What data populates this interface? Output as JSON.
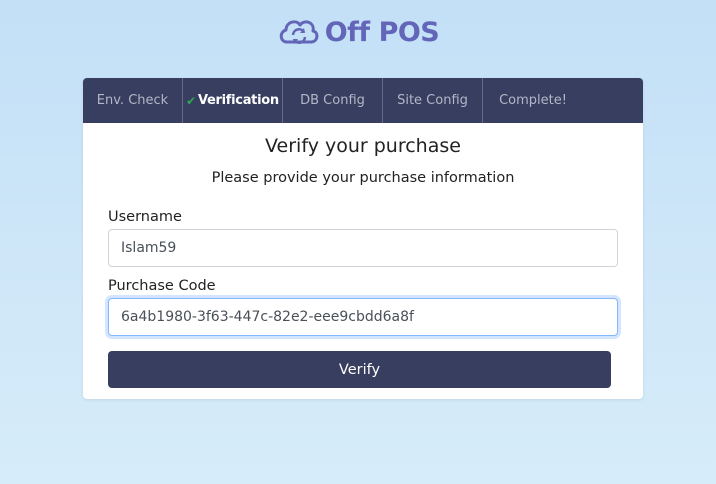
{
  "logo": {
    "text": "Off POS"
  },
  "tabs": [
    {
      "label": "Env. Check",
      "active": false
    },
    {
      "label": "Verification",
      "active": true,
      "completed": true
    },
    {
      "label": "DB Config",
      "active": false
    },
    {
      "label": "Site Config",
      "active": false
    },
    {
      "label": "Complete!",
      "active": false
    }
  ],
  "form": {
    "title": "Verify your purchase",
    "subtitle": "Please provide your purchase information",
    "username_label": "Username",
    "username_value": "Islam59",
    "purchase_code_label": "Purchase Code",
    "purchase_code_value": "6a4b1980-3f63-447c-82e2-eee9cbdd6a8f",
    "verify_label": "Verify"
  },
  "colors": {
    "brand": "#6366b8",
    "tab_bar": "#373e5f",
    "check": "#2fa84f",
    "button": "#373e5f"
  }
}
